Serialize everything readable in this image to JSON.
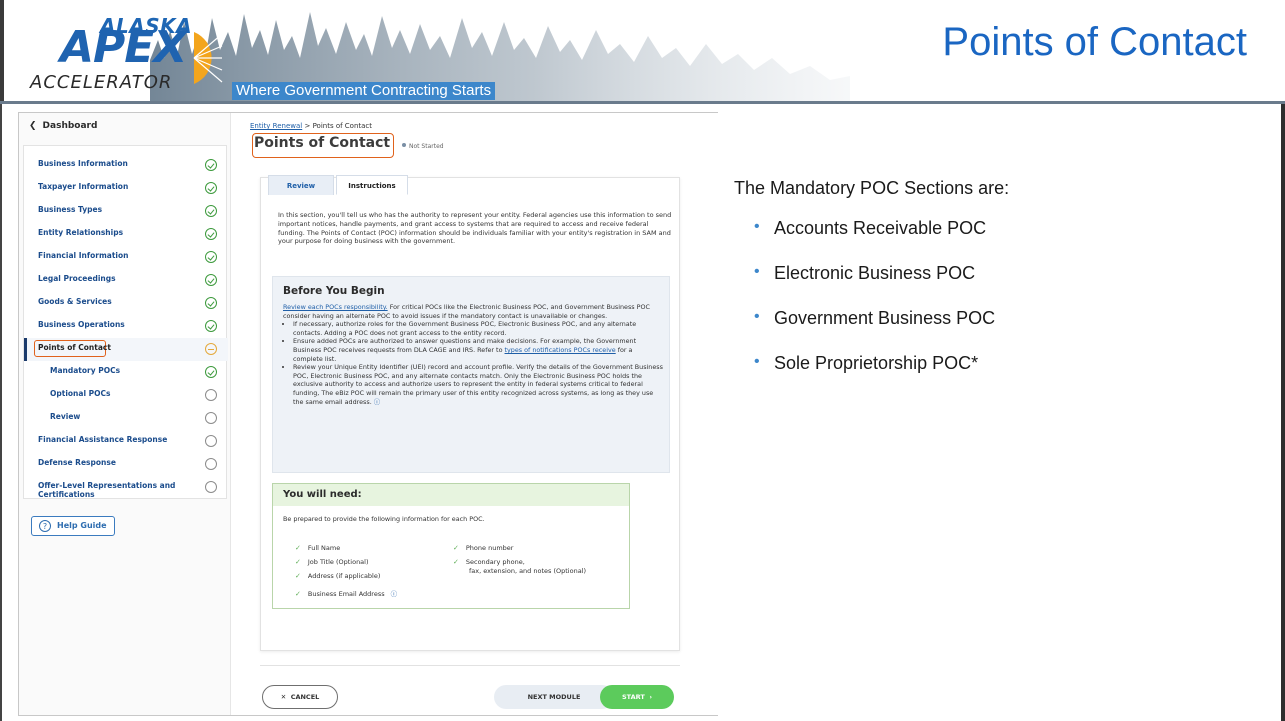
{
  "slide": {
    "title": "Points of Contact",
    "tagline": "Where Government Contracting Starts",
    "logo": {
      "top": "ALASKA",
      "middle": "APEX",
      "bottom": "ACCELERATOR"
    }
  },
  "sidebar": {
    "back_label": "Dashboard",
    "items": [
      {
        "label": "Business Information",
        "status": "complete"
      },
      {
        "label": "Taxpayer Information",
        "status": "complete"
      },
      {
        "label": "Business Types",
        "status": "complete"
      },
      {
        "label": "Entity Relationships",
        "status": "complete"
      },
      {
        "label": "Financial Information",
        "status": "complete"
      },
      {
        "label": "Legal Proceedings",
        "status": "complete"
      },
      {
        "label": "Goods & Services",
        "status": "complete"
      },
      {
        "label": "Business Operations",
        "status": "complete"
      },
      {
        "label": "Points of Contact",
        "status": "in-progress"
      },
      {
        "label": "Mandatory POCs",
        "status": "complete"
      },
      {
        "label": "Optional POCs",
        "status": "not-started"
      },
      {
        "label": "Review",
        "status": "not-started"
      },
      {
        "label": "Financial Assistance Response",
        "status": "not-started"
      },
      {
        "label": "Defense Response",
        "status": "not-started"
      },
      {
        "label": "Offer-Level Representations and Certifications",
        "status": "not-started"
      }
    ],
    "help_label": "Help Guide"
  },
  "main": {
    "breadcrumb_link": "Entity Renewal",
    "breadcrumb_sep": " > ",
    "breadcrumb_current": "Points of Contact",
    "page_title": "Points of Contact",
    "status_label": "Not Started",
    "tabs": [
      "Review",
      "Instructions"
    ],
    "intro": "In this section, you'll tell us who has the authority to represent your entity. Federal agencies use this information to send important notices, handle payments, and grant access to systems that are required to access and receive federal funding. The Points of Contact (POC) information should be individuals familiar with your entity's registration in SAM and your purpose for doing business with the government.",
    "before_title": "Before You Begin",
    "before_link": "Review each POCs responsibility.",
    "before_lead": " For critical POCs like the Electronic Business POC, and Government Business POC consider having an alternate POC to avoid issues if the mandatory contact is unavailable or changes.",
    "bullet1": "If necessary, authorize roles for the Government Business POC, Electronic Business POC, and any alternate contacts. Adding a POC does not grant access to the entity record.",
    "bullet2_a": "Ensure added POCs are authorized to answer questions and make decisions. For example, the Government Business POC receives requests from DLA CAGE and IRS. Refer to ",
    "bullet2_link": "types of notifications POCs receive",
    "bullet2_b": " for a complete list.",
    "bullet3": "Review your Unique Entity Identifier (UEI) record and account profile. Verify the details of the Government Business POC, Electronic Business POC, and any alternate contacts match. Only the Electronic Business POC holds the exclusive authority to access and authorize users to represent the entity in federal systems critical to federal funding, The eBiz POC will remain the primary user of this entity recognized across systems, as long as they use the same email address.",
    "need_title": "You will need:",
    "need_sub": "Be prepared to provide the following information for each POC.",
    "need_left": [
      "Full Name",
      "Job Title (Optional)",
      "Address (if applicable)",
      "Business Email Address"
    ],
    "need_right": [
      "Phone number",
      "Secondary phone,",
      "fax, extension, and notes (Optional)"
    ],
    "cancel_label": "CANCEL",
    "next_label": "NEXT MODULE",
    "start_label": "START"
  },
  "panel": {
    "heading": "The Mandatory POC Sections are:",
    "items": [
      "Accounts Receivable POC",
      "Electronic Business POC",
      "Government Business POC",
      "Sole Proprietorship POC*"
    ]
  },
  "colors": {
    "title_blue": "#1a66c2",
    "highlight_orange": "#e0621c",
    "success_green": "#3d9a3d",
    "start_green": "#5ccb5c",
    "link_blue": "#1f5fa8"
  }
}
